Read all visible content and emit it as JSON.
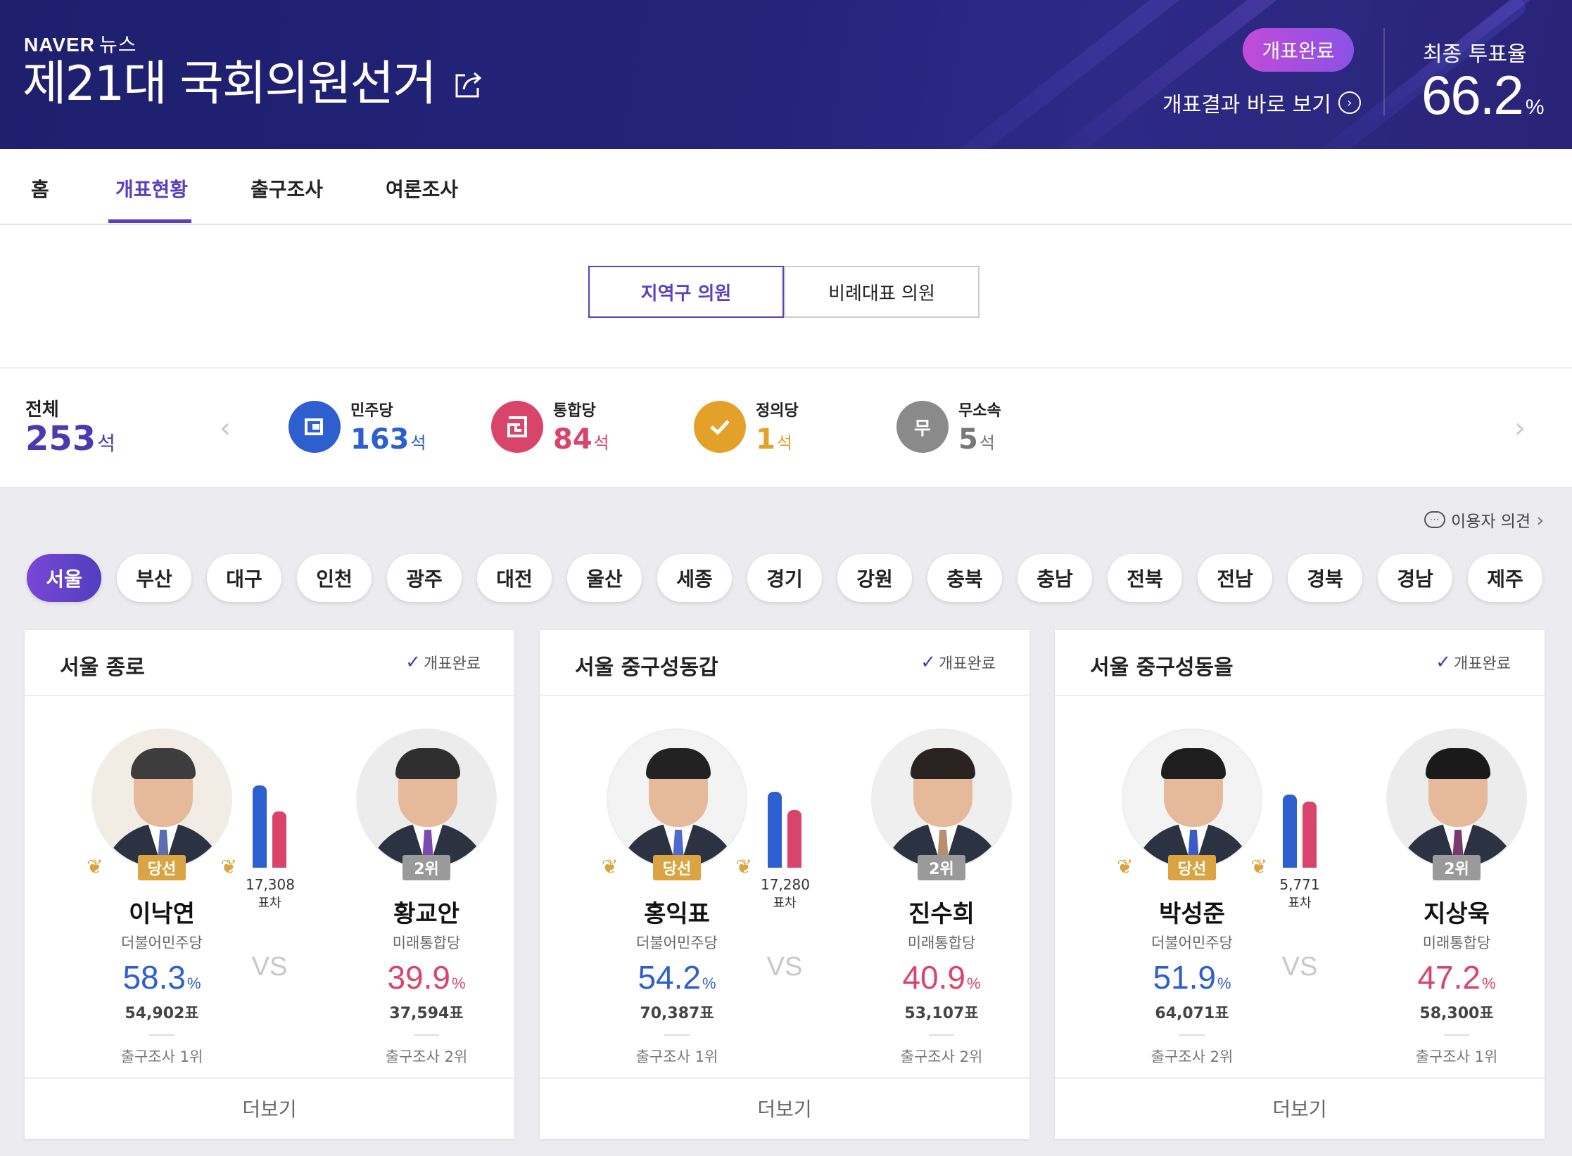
{
  "header": {
    "brand": "NAVER",
    "brand_sub": "뉴스",
    "title": "제21대 국회의원선거",
    "status_pill": "개표완료",
    "result_link": "개표결과 바로 보기",
    "turnout_label": "최종 투표율",
    "turnout_value": "66.2",
    "turnout_unit": "%",
    "colors": {
      "bg": "#23237a",
      "pill": "#a04fe0"
    }
  },
  "nav": {
    "items": [
      {
        "label": "홈"
      },
      {
        "label": "개표현황",
        "active": true
      },
      {
        "label": "출구조사"
      },
      {
        "label": "여론조사"
      }
    ]
  },
  "segments": {
    "items": [
      {
        "label": "지역구 의원",
        "active": true
      },
      {
        "label": "비례대표 의원"
      }
    ]
  },
  "summary": {
    "total_label": "전체",
    "total_value": "253",
    "unit": "석",
    "parties": [
      {
        "name": "민주당",
        "seats": "163",
        "color": "#2d5fcf",
        "icon": "minjoo-logo-icon"
      },
      {
        "name": "통합당",
        "seats": "84",
        "color": "#d9456a",
        "icon": "tonghap-logo-icon"
      },
      {
        "name": "정의당",
        "seats": "1",
        "color": "#e4a12a",
        "icon": "check-logo-icon"
      },
      {
        "name": "무소속",
        "seats": "5",
        "color": "#8a8a8a",
        "icon_text": "무"
      }
    ]
  },
  "feedback": {
    "label": "이용자 의견"
  },
  "regions": [
    "서울",
    "부산",
    "대구",
    "인천",
    "광주",
    "대전",
    "울산",
    "세종",
    "경기",
    "강원",
    "충북",
    "충남",
    "전북",
    "전남",
    "경북",
    "경남",
    "제주"
  ],
  "active_region": "서울",
  "cards": [
    {
      "title": "서울 종로",
      "status": "개표완료",
      "gap_value": "17,308",
      "gap_label": "표차",
      "vs": "VS",
      "more": "더보기",
      "left": {
        "badge": "당선",
        "name": "이낙연",
        "party": "더불어민주당",
        "rate": "58.3",
        "votes": "54,902표",
        "exit": "출구조사 1위"
      },
      "right": {
        "badge": "2위",
        "name": "황교안",
        "party": "미래통합당",
        "rate": "39.9",
        "votes": "37,594표",
        "exit": "출구조사 2위"
      }
    },
    {
      "title": "서울 중구성동갑",
      "status": "개표완료",
      "gap_value": "17,280",
      "gap_label": "표차",
      "vs": "VS",
      "more": "더보기",
      "left": {
        "badge": "당선",
        "name": "홍익표",
        "party": "더불어민주당",
        "rate": "54.2",
        "votes": "70,387표",
        "exit": "출구조사 1위"
      },
      "right": {
        "badge": "2위",
        "name": "진수희",
        "party": "미래통합당",
        "rate": "40.9",
        "votes": "53,107표",
        "exit": "출구조사 2위"
      }
    },
    {
      "title": "서울 중구성동을",
      "status": "개표완료",
      "gap_value": "5,771",
      "gap_label": "표차",
      "vs": "VS",
      "more": "더보기",
      "left": {
        "badge": "당선",
        "name": "박성준",
        "party": "더불어민주당",
        "rate": "51.9",
        "votes": "64,071표",
        "exit": "출구조사 2위"
      },
      "right": {
        "badge": "2위",
        "name": "지상욱",
        "party": "미래통합당",
        "rate": "47.2",
        "votes": "58,300표",
        "exit": "출구조사 1위"
      }
    }
  ],
  "pct_unit": "%"
}
